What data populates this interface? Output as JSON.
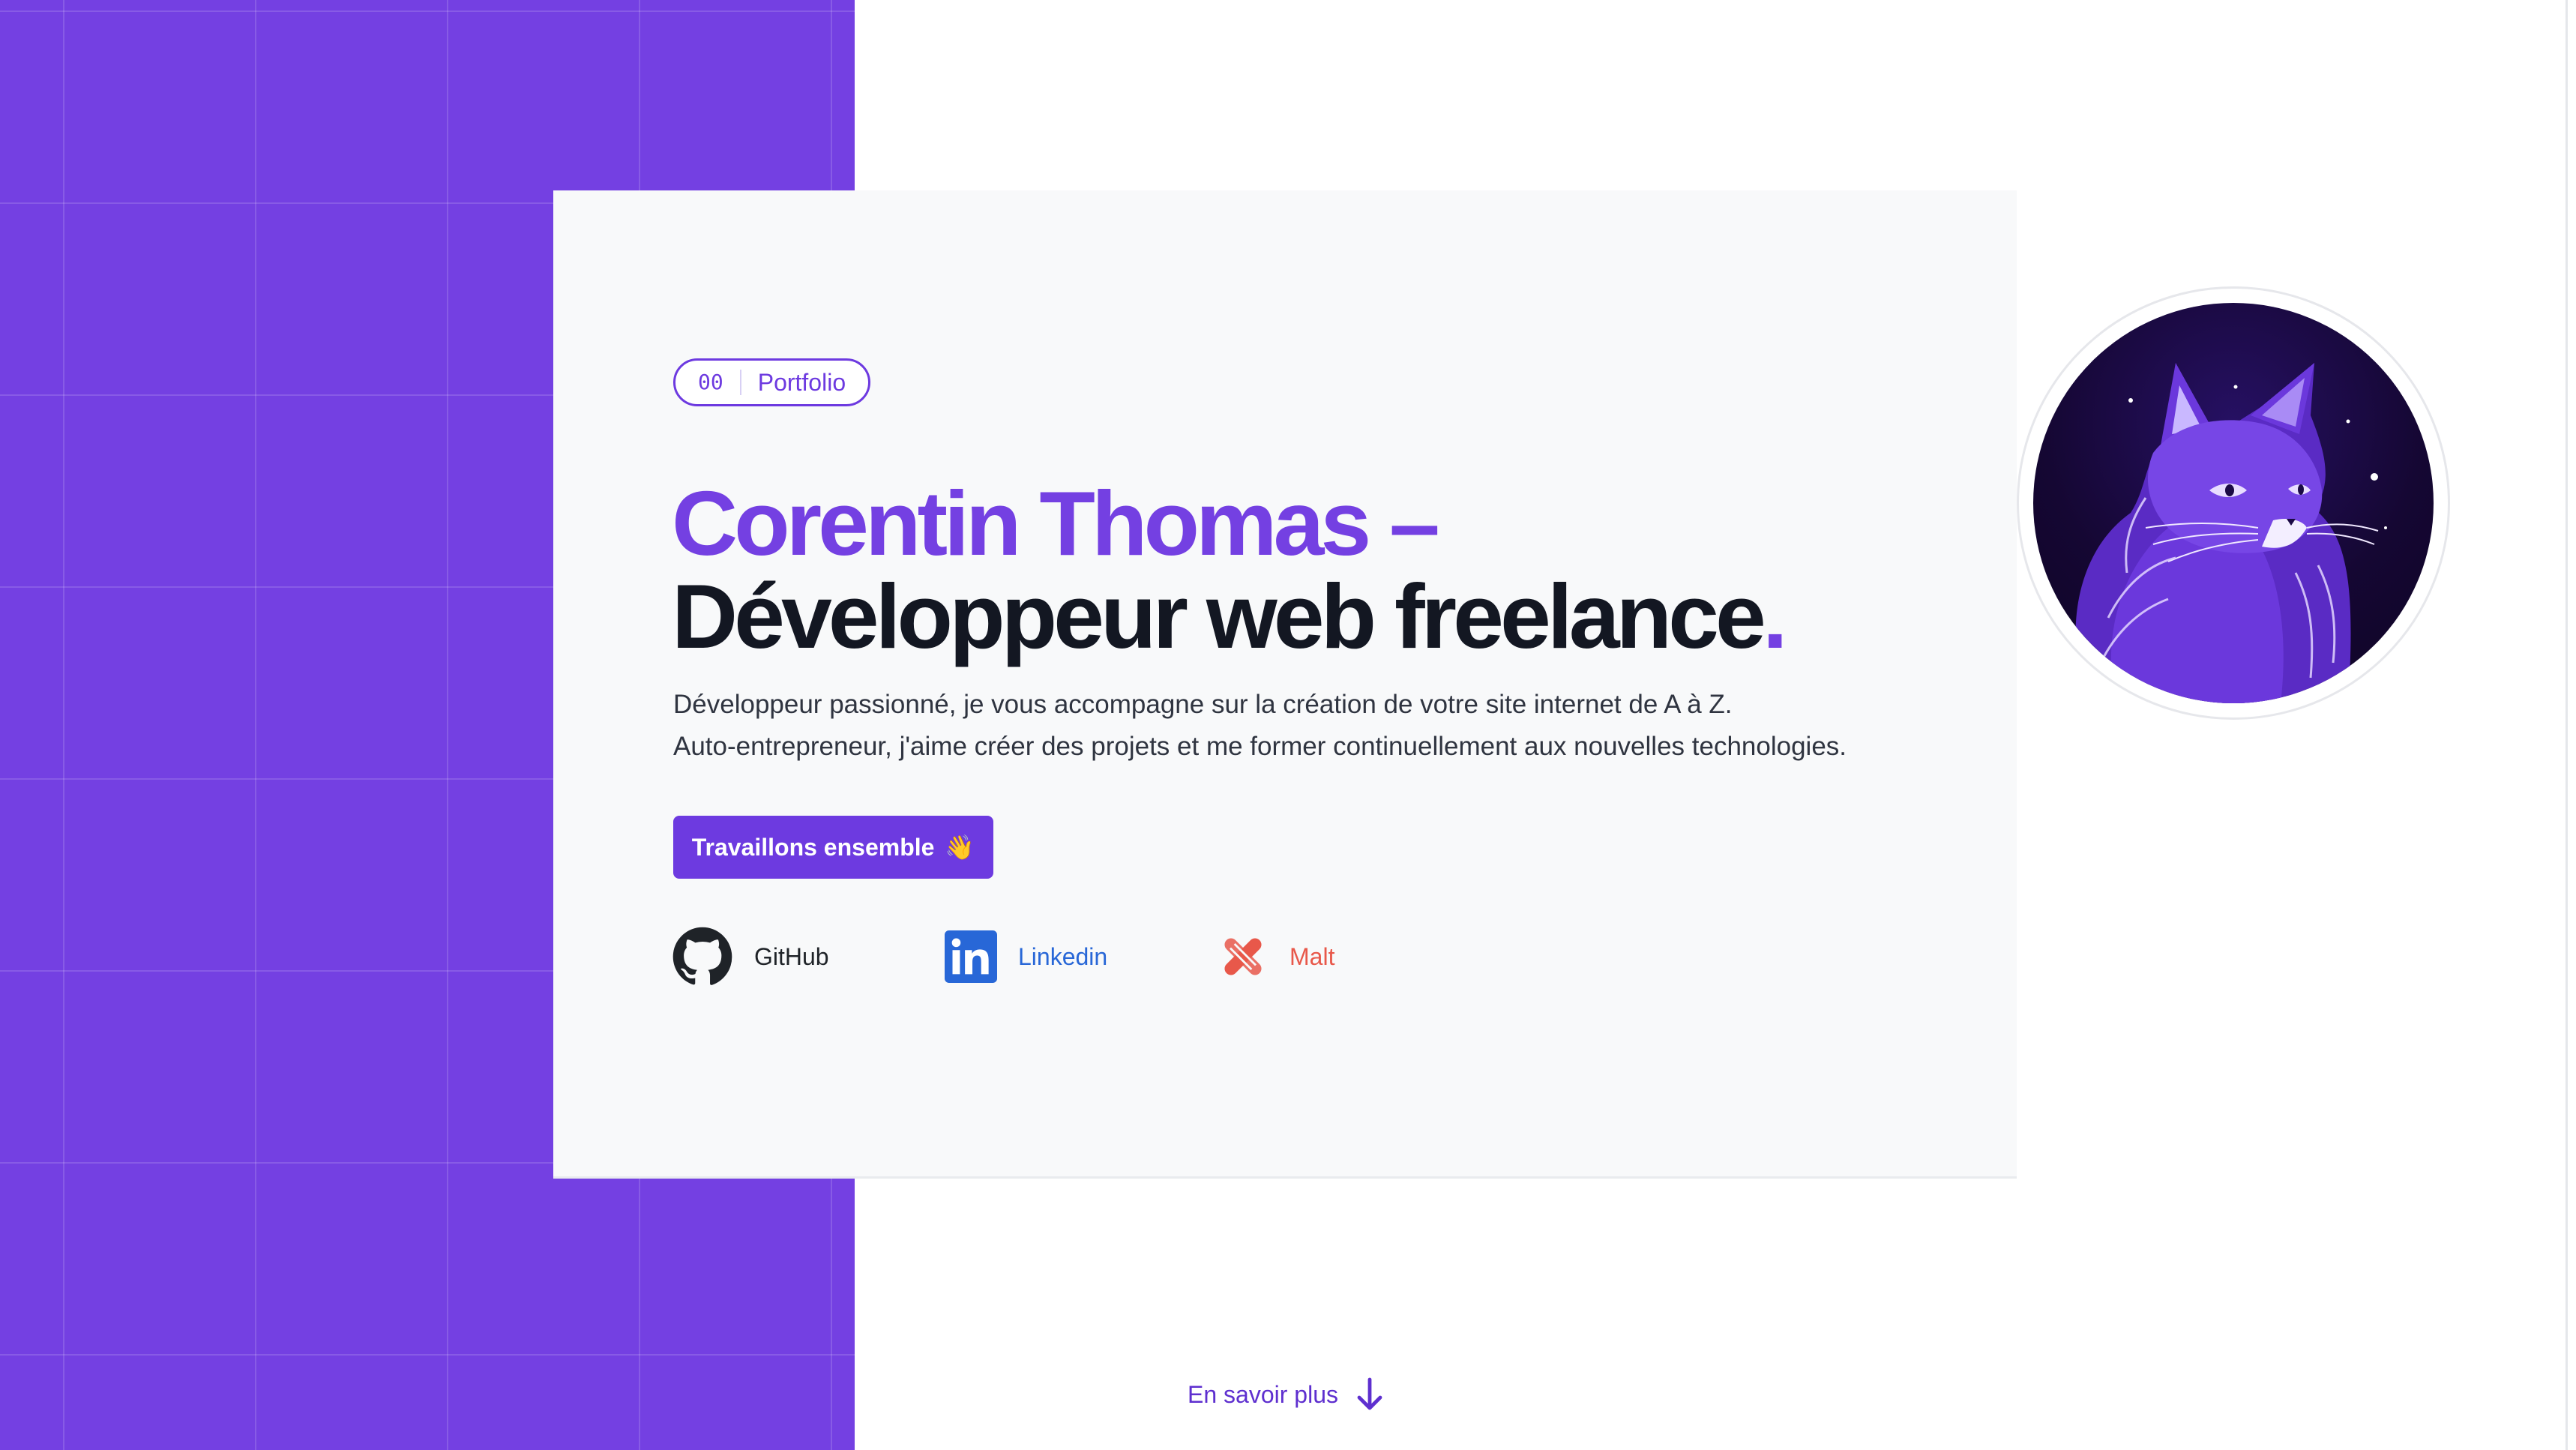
{
  "chip": {
    "number": "00",
    "label": "Portfolio"
  },
  "headline": {
    "line1": "Corentin Thomas –",
    "line2": "Développeur web freelance",
    "line2_dot": "."
  },
  "intro": {
    "line1": "Développeur passionné, je vous accompagne sur la création de votre site internet de A à Z.",
    "line2": "Auto-entrepreneur, j'aime créer des projets et me former continuellement aux nouvelles technologies."
  },
  "cta": {
    "label": "Travaillons ensemble",
    "emoji": "👋"
  },
  "socials": [
    {
      "label": "GitHub",
      "icon": "github-icon"
    },
    {
      "label": "Linkedin",
      "icon": "linkedin-icon"
    },
    {
      "label": "Malt",
      "icon": "malt-icon"
    }
  ],
  "more": {
    "label": "En savoir plus",
    "icon": "arrow-down-icon"
  },
  "colors": {
    "accent": "#7440e2",
    "heading": "#131722",
    "linkedin": "#2867d7",
    "malt": "#e8584a"
  }
}
